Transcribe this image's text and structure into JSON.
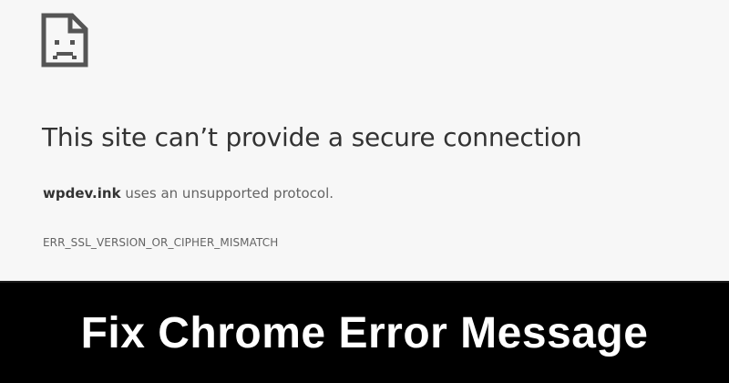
{
  "error_page": {
    "icon": "sad-page-icon",
    "title": "This site can’t provide a secure connection",
    "host": "wpdev.ink",
    "message_suffix": " uses an unsupported protocol.",
    "error_code": "ERR_SSL_VERSION_OR_CIPHER_MISMATCH"
  },
  "banner": {
    "text": "Fix Chrome Error Message"
  },
  "colors": {
    "page_background": "#f7f7f7",
    "title_text": "#333333",
    "body_text": "#646464",
    "banner_background": "#000000",
    "banner_text": "#ffffff"
  }
}
